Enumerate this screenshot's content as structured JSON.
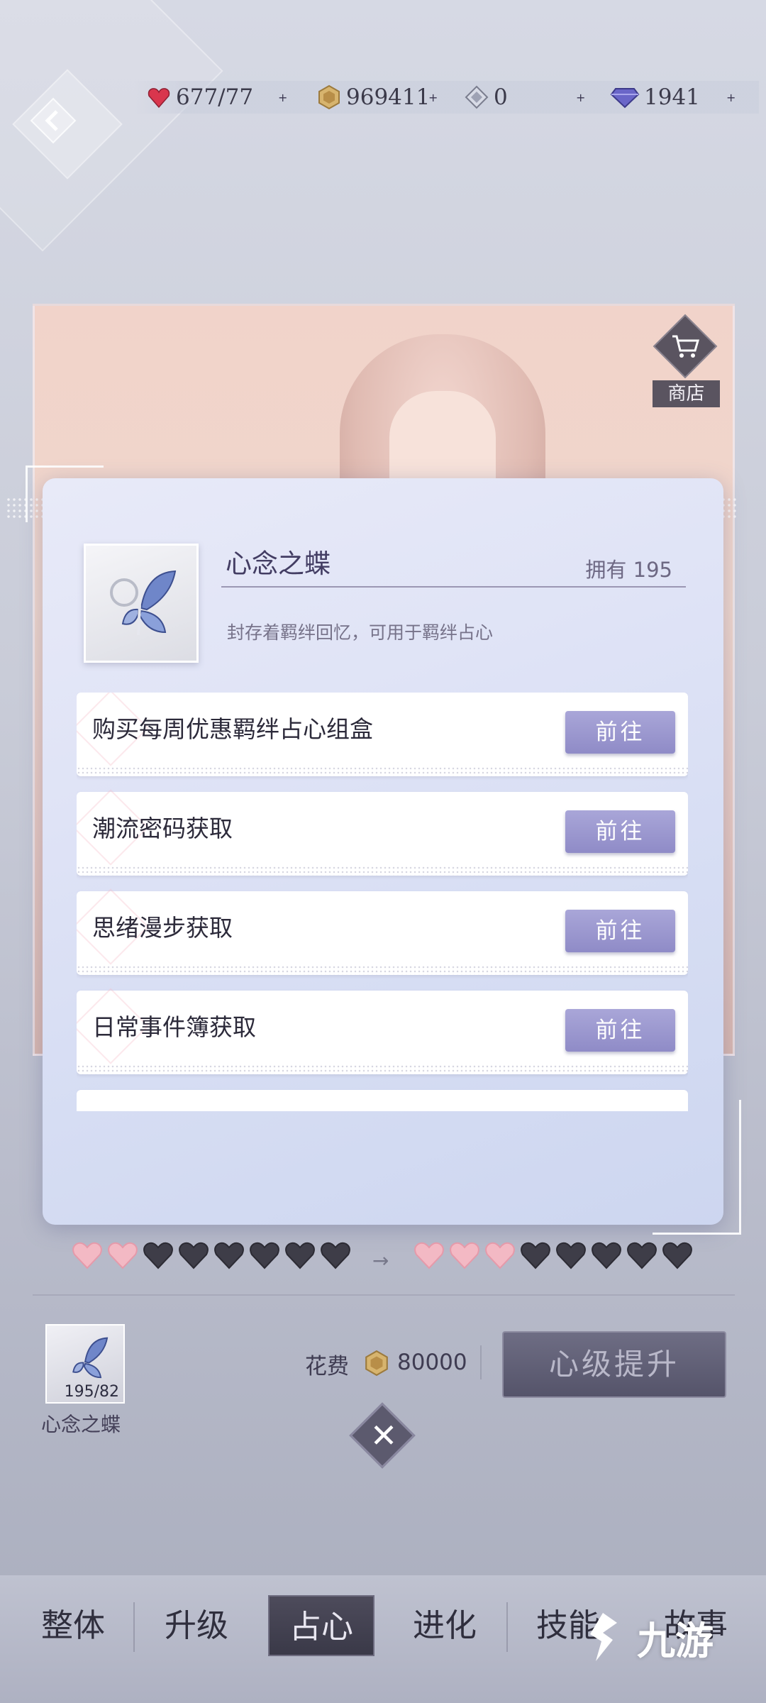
{
  "resources": {
    "stamina": {
      "value": "677/77",
      "icon": "heart-gem-icon",
      "color": "#d9364d"
    },
    "gold": {
      "value": "969411",
      "icon": "gold-coin-icon",
      "color": "#c8a25a"
    },
    "crystal": {
      "value": "0",
      "icon": "crystal-icon"
    },
    "diamond": {
      "value": "1941",
      "icon": "diamond-icon",
      "color": "#5b57b8"
    },
    "plus": "+"
  },
  "shop": {
    "label": "商店"
  },
  "popup": {
    "item": {
      "name": "心念之蝶",
      "owned": "拥有 195",
      "description": "封存着羁绊回忆，可用于羁绊占心"
    },
    "sources": [
      {
        "label": "购买每周优惠羁绊占心组盒",
        "button": "前往"
      },
      {
        "label": "潮流密码获取",
        "button": "前往"
      },
      {
        "label": "思绪漫步获取",
        "button": "前往"
      },
      {
        "label": "日常事件簿获取",
        "button": "前往"
      }
    ]
  },
  "hearts": {
    "current": {
      "filled": 2,
      "total": 8
    },
    "next": {
      "filled": 3,
      "total": 8
    },
    "arrow": "→"
  },
  "material": {
    "count": "195/82",
    "name": "心念之蝶"
  },
  "cost": {
    "label": "花费",
    "value": "80000"
  },
  "upgrade_button": "心级提升",
  "close_symbol": "✕",
  "tabs": [
    {
      "label": "整体"
    },
    {
      "label": "升级"
    },
    {
      "label": "占心",
      "active": true
    },
    {
      "label": "进化"
    },
    {
      "label": "技能"
    },
    {
      "label": "故事"
    }
  ],
  "watermark": "九游",
  "colors": {
    "accent_button": "#9a97cf",
    "heart_pink": "#f3b9c4",
    "heart_dark": "#3e3d48"
  }
}
